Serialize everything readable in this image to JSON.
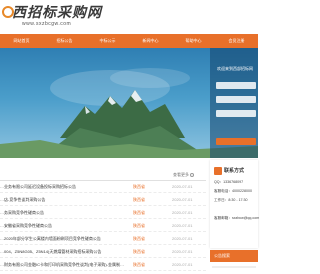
{
  "header": {
    "logo_text": "西招标采购网",
    "logo_url": "www.sxzbcgw.com"
  },
  "nav": {
    "items": [
      "网站首页",
      "招标公告",
      "中标公示",
      "新闻中心",
      "帮助中心",
      "会员注册"
    ]
  },
  "banner": {
    "login_title": "欢迎来到西部招标网"
  },
  "list": {
    "more_label": "查看更多",
    "rows": [
      {
        "title": "…业务有限公司延迟设备投标采购招标公告",
        "region": "陕西省",
        "date": "2020-07-01"
      },
      {
        "title": "…店-竞争性谈判采购公告",
        "region": "陕西省",
        "date": "2020-07-01"
      },
      {
        "title": "…务采购竞争性磋商公告",
        "region": "陕西省",
        "date": "2020-07-01"
      },
      {
        "title": "…安徽省采购竞争性磋商公告",
        "region": "陕西省",
        "date": "2020-07-01"
      },
      {
        "title": "…2020年部分学生公寓楼内墙面粉刷项目竞争性磋商公告",
        "region": "陕西省",
        "date": "2020-07-01"
      },
      {
        "title": "…004、Z5N8G05、Z5N14)天燃煤管材采购招标采购公告",
        "region": "陕西省",
        "date": "2020-07-01"
      },
      {
        "title": "…财务有限公司金融IC卡和打印机采购竞争性谈判(电子采购)-金属制…",
        "region": "陕西省",
        "date": "2020-07-01"
      }
    ]
  },
  "contact": {
    "title": "联系方式",
    "lines": [
      "QQ：1336768097",
      "客服电话：4000228000",
      "工作日：8:30 - 17:30",
      "",
      "客服邮箱：sxzbcw@qq.com"
    ]
  },
  "bottom_tab": {
    "label": "公告搜索"
  }
}
